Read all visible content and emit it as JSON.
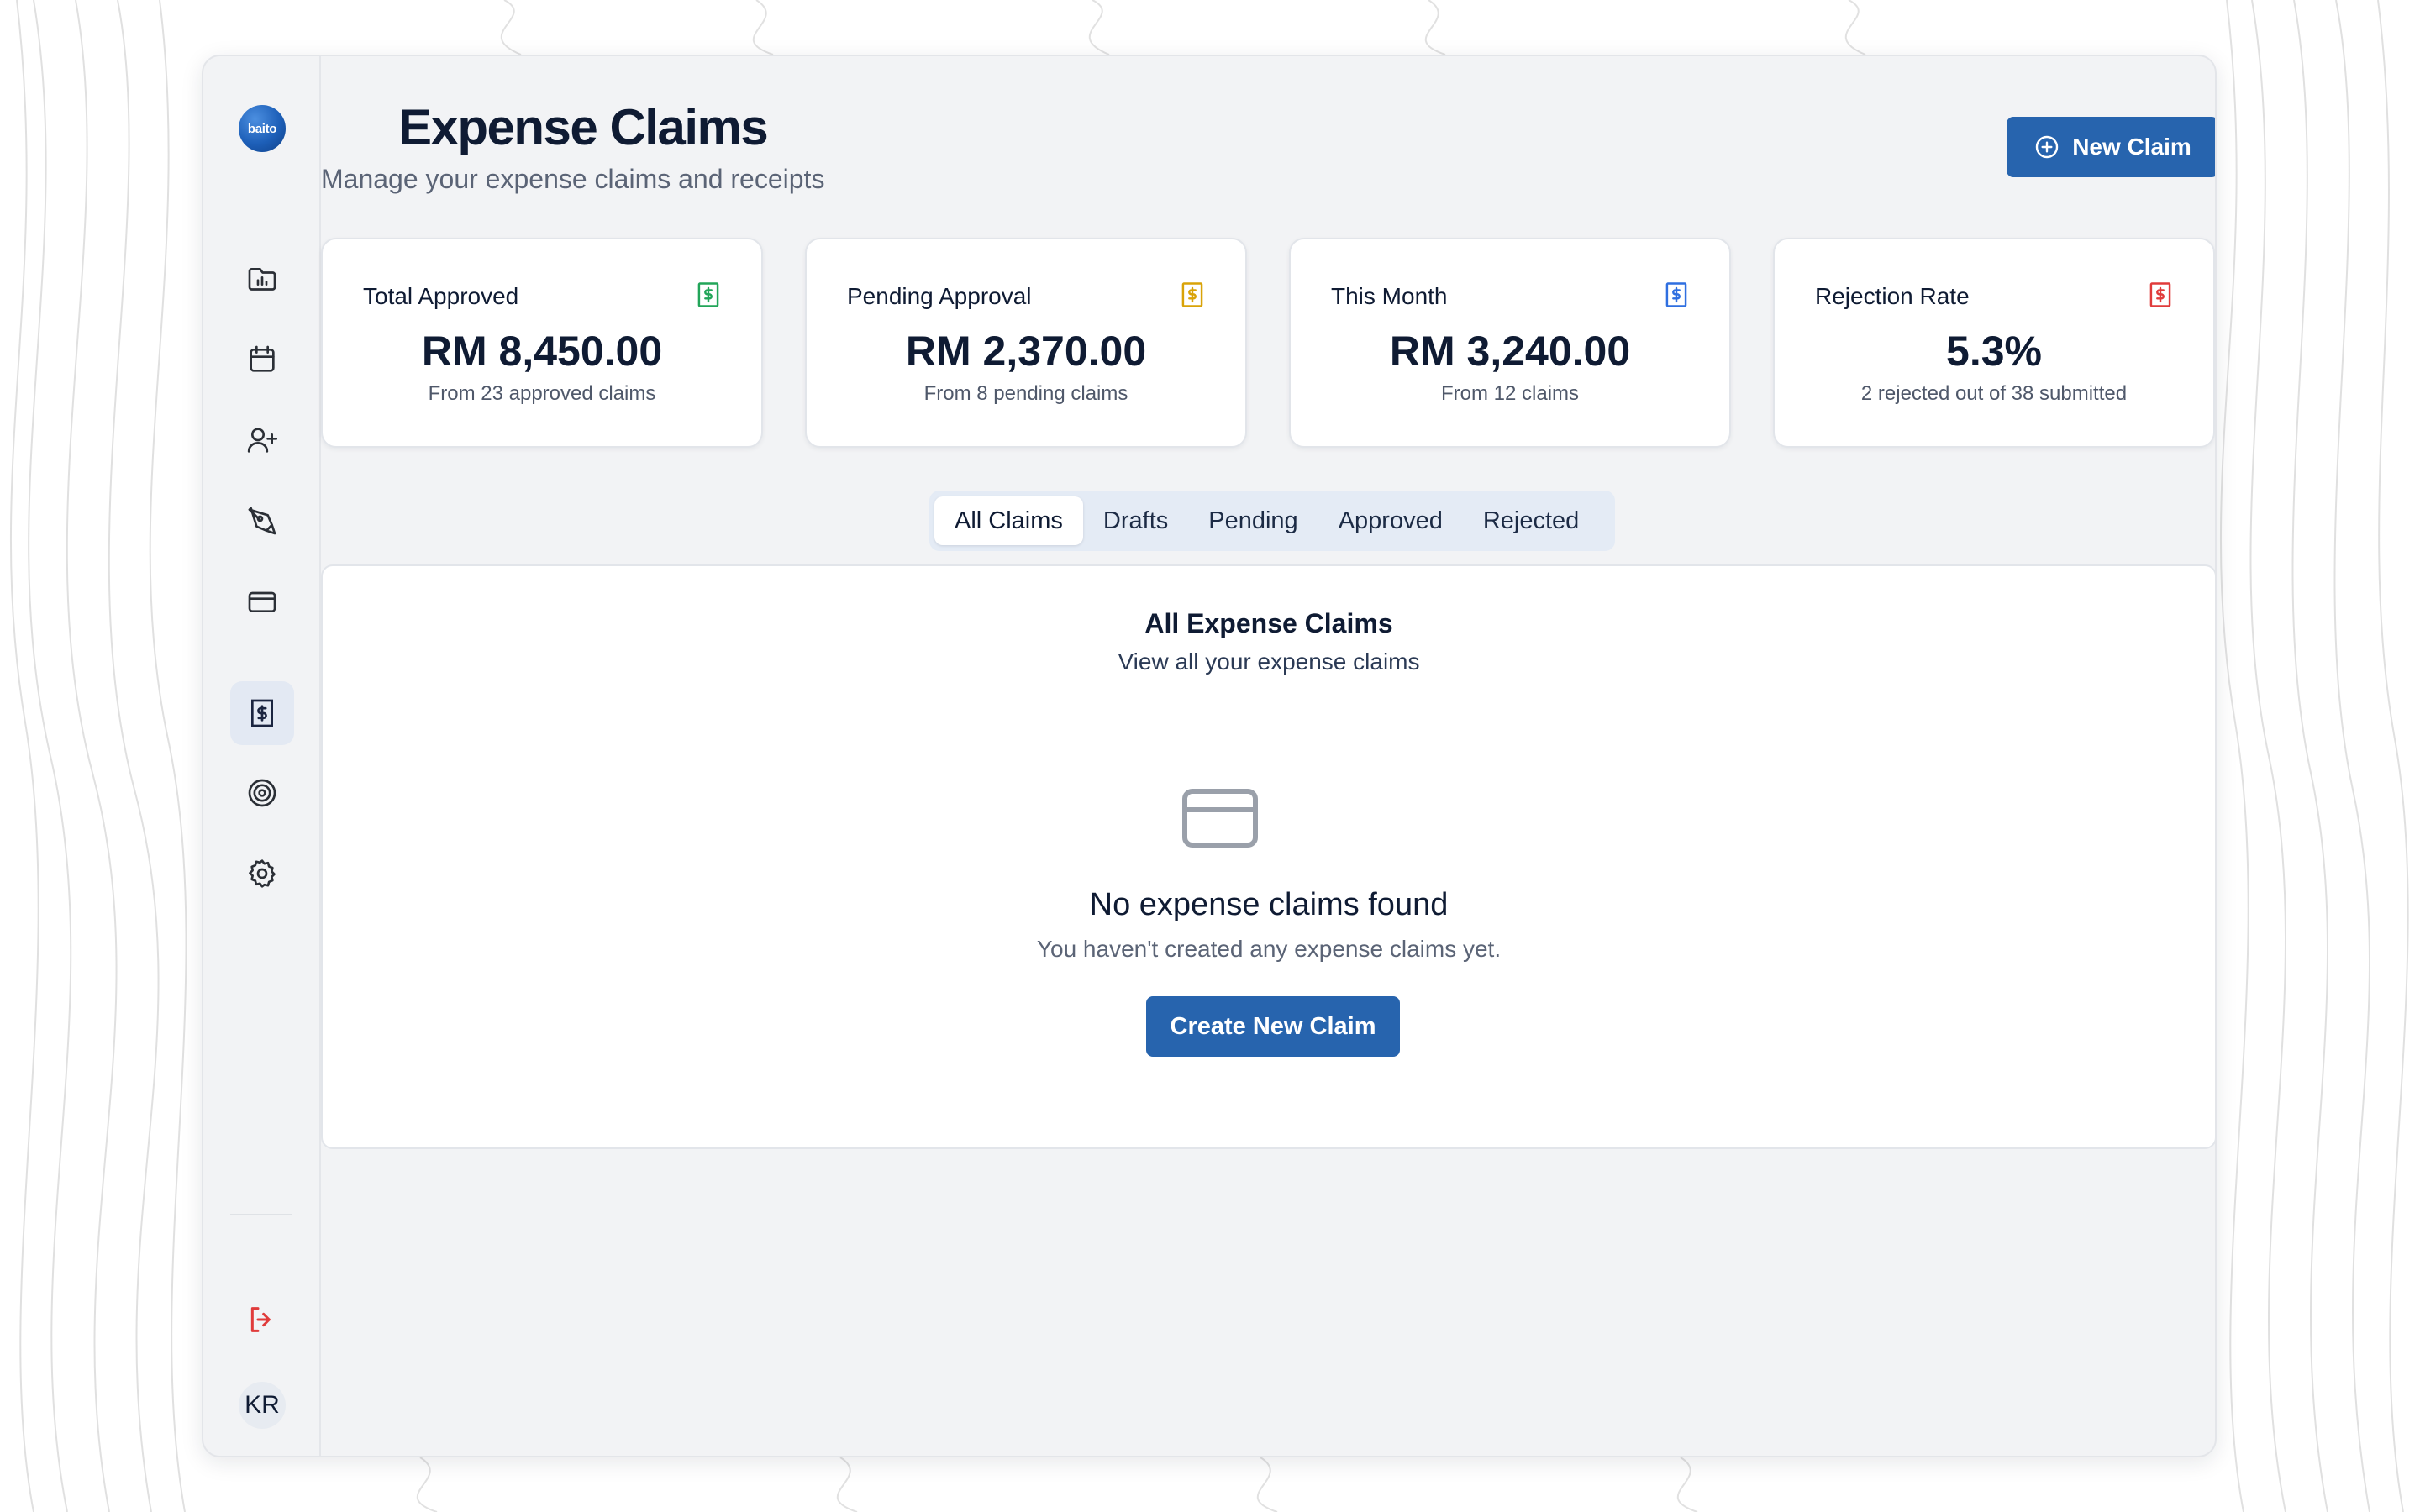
{
  "app": {
    "logo_text": "baito"
  },
  "header": {
    "title": "Expense Claims",
    "subtitle": "Manage your expense claims and receipts",
    "new_claim_label": "New Claim"
  },
  "sidebar": {
    "items": [
      {
        "name": "projects",
        "icon": "folder-chart-icon",
        "active": false
      },
      {
        "name": "calendar",
        "icon": "calendar-icon",
        "active": false
      },
      {
        "name": "candidates",
        "icon": "user-plus-icon",
        "active": false
      },
      {
        "name": "tools",
        "icon": "pen-tool-icon",
        "active": false
      },
      {
        "name": "payments",
        "icon": "credit-card-icon",
        "active": false
      },
      {
        "name": "expense-claims",
        "icon": "receipt-dollar-icon",
        "active": true
      },
      {
        "name": "goals",
        "icon": "target-icon",
        "active": false
      },
      {
        "name": "settings",
        "icon": "gear-icon",
        "active": false
      }
    ],
    "logout_icon": "logout-icon",
    "user_initials": "KR"
  },
  "stats": [
    {
      "label": "Total Approved",
      "value": "RM 8,450.00",
      "sub": "From 23 approved claims",
      "color": "#22a559"
    },
    {
      "label": "Pending Approval",
      "value": "RM 2,370.00",
      "sub": "From 8 pending claims",
      "color": "#d9a308"
    },
    {
      "label": "This Month",
      "value": "RM 3,240.00",
      "sub": "From 12 claims",
      "color": "#2f6fe0"
    },
    {
      "label": "Rejection Rate",
      "value": "5.3%",
      "sub": "2 rejected out of 38 submitted",
      "color": "#e03b3b"
    }
  ],
  "tabs": [
    {
      "label": "All Claims",
      "active": true
    },
    {
      "label": "Drafts",
      "active": false
    },
    {
      "label": "Pending",
      "active": false
    },
    {
      "label": "Approved",
      "active": false
    },
    {
      "label": "Rejected",
      "active": false
    }
  ],
  "panel": {
    "title": "All Expense Claims",
    "description": "View all your expense claims",
    "empty_title": "No expense claims found",
    "empty_description": "You haven't created any expense claims yet.",
    "create_label": "Create New Claim"
  },
  "colors": {
    "primary": "#2764ae",
    "text": "#0f1b33",
    "muted": "#5b6476"
  }
}
